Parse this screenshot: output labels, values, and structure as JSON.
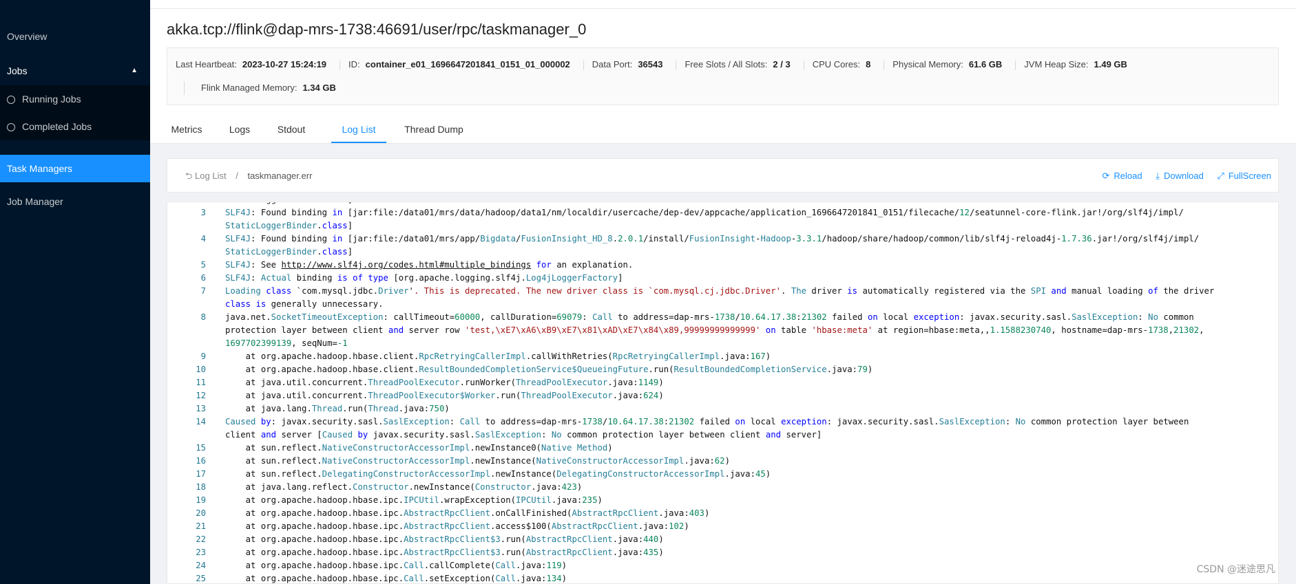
{
  "sidebar": {
    "items": [
      {
        "label": "Overview"
      },
      {
        "label": "Jobs"
      },
      {
        "label": "Running Jobs"
      },
      {
        "label": "Completed Jobs"
      },
      {
        "label": "Task Managers"
      },
      {
        "label": "Job Manager"
      }
    ]
  },
  "title": "akka.tcp://flink@dap-mrs-1738:46691/user/rpc/taskmanager_0",
  "info": {
    "heartbeat_label": "Last Heartbeat:",
    "heartbeat": "2023-10-27 15:24:19",
    "id_label": "ID:",
    "id": "container_e01_1696647201841_0151_01_000002",
    "port_label": "Data Port:",
    "port": "36543",
    "slots_label": "Free Slots / All Slots:",
    "slots": "2 / 3",
    "cpu_label": "CPU Cores:",
    "cpu": "8",
    "mem_label": "Physical Memory:",
    "mem": "61.6 GB",
    "heap_label": "JVM Heap Size:",
    "heap": "1.49 GB",
    "managed_label": "Flink Managed Memory:",
    "managed": "1.34 GB"
  },
  "tabs": [
    {
      "label": "Metrics"
    },
    {
      "label": "Logs"
    },
    {
      "label": "Stdout"
    },
    {
      "label": "Log List"
    },
    {
      "label": "Thread Dump"
    }
  ],
  "loghead": {
    "back_label": "Log List",
    "sep": "/",
    "file": "taskmanager.err",
    "reload": "Reload",
    "download": "Download",
    "fullscreen": "FullScreen"
  },
  "log": {
    "numbers": [
      "3",
      "4",
      "5",
      "6",
      "7",
      "8",
      "9",
      "10",
      "11",
      "12",
      "13",
      "14",
      "15",
      "16",
      "17",
      "18",
      "19",
      "20",
      "21",
      "22",
      "23",
      "24",
      "25"
    ]
  },
  "watermark": "CSDN @迷途思凡",
  "colors": {
    "sidebar": "#001529",
    "active": "#1890ff",
    "keyword": "#0000ff",
    "type": "#267f99",
    "number": "#098658",
    "string": "#a31515"
  }
}
